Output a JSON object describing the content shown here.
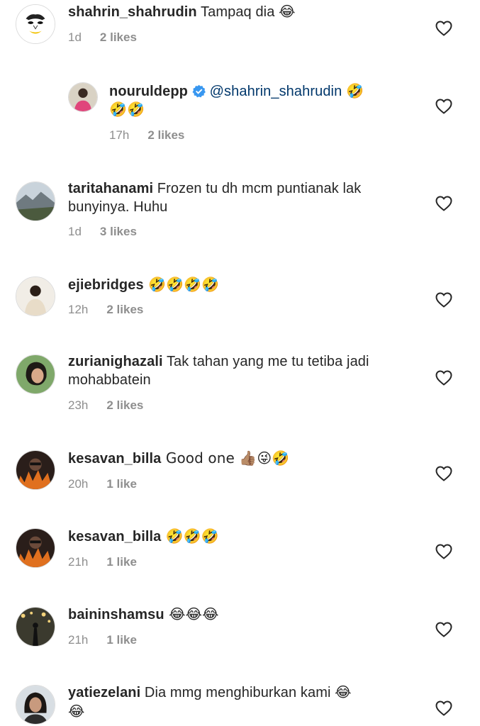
{
  "comments": [
    {
      "username": "shahrin_shahrudin",
      "text": " Tampaq dia 😂",
      "time": "1d",
      "likes": "2 likes"
    },
    {
      "username": "nouruldepp",
      "mention": "@shahrin_shahrudin",
      "text": " 🤣",
      "text2": "🤣🤣",
      "time": "17h",
      "likes": "2 likes"
    },
    {
      "username": "taritahanami",
      "text": " Frozen tu dh mcm puntianak lak",
      "text2": "bunyinya. Huhu",
      "time": "1d",
      "likes": "3 likes"
    },
    {
      "username": "ejiebridges",
      "text": " 🤣🤣🤣🤣",
      "time": "12h",
      "likes": "2 likes"
    },
    {
      "username": "zurianighazali",
      "text": " Tak tahan yang me tu tetiba jadi",
      "text2": "mohabbatein",
      "time": "23h",
      "likes": "2 likes"
    },
    {
      "username": "kesavan_billa",
      "text": " Good one 👍🏽😜🤣",
      "time": "20h",
      "likes": "1 like"
    },
    {
      "username": "kesavan_billa",
      "text": " 🤣🤣🤣",
      "time": "21h",
      "likes": "1 like"
    },
    {
      "username": "baininshamsu",
      "text": " 😂😂😂",
      "time": "21h",
      "likes": "1 like"
    },
    {
      "username": "yatiezelani",
      "text": " Dia mmg menghiburkan kami 😂",
      "text2": "😂",
      "time": "",
      "likes": ""
    }
  ]
}
